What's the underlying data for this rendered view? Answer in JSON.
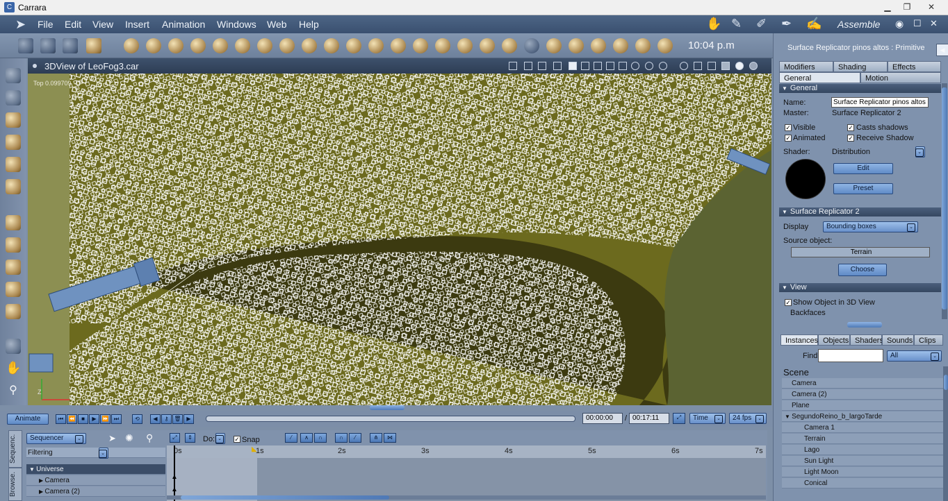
{
  "window": {
    "title": "Carrara",
    "min": "▁",
    "max": "❐",
    "close": "✕"
  },
  "menu": {
    "items": [
      "File",
      "Edit",
      "View",
      "Insert",
      "Animation",
      "Windows",
      "Web",
      "Help"
    ],
    "room": "Assemble"
  },
  "toolbar": {
    "clock": "10:04 p.m"
  },
  "view": {
    "title": "3DView of LeoFog3.car",
    "readout": "Top 0.099709"
  },
  "properties": {
    "header": "Surface Replicator pinos altos : Primitive",
    "tabs_row1": [
      "Modifiers",
      "Shading",
      "Effects"
    ],
    "tabs_row2": [
      "General",
      "Motion"
    ],
    "general": {
      "section": "General",
      "name_label": "Name:",
      "name_value": "Surface Replicator pinos altos",
      "master_label": "Master:",
      "master_value": "Surface Replicator 2",
      "visible": "Visible",
      "casts_shadows": "Casts shadows",
      "animated": "Animated",
      "receive_shadow": "Receive Shadow",
      "shader_label": "Shader:",
      "shader_value": "Distribution",
      "edit": "Edit",
      "preset": "Preset"
    },
    "replicator": {
      "section": "Surface Replicator 2",
      "display_label": "Display",
      "display_value": "Bounding boxes",
      "source_label": "Source object:",
      "source_value": "Terrain",
      "choose": "Choose"
    },
    "viewsec": {
      "section": "View",
      "show_object": "Show Object in 3D View",
      "backfaces": "Backfaces"
    }
  },
  "browser": {
    "tabs": [
      "Instances",
      "Objects",
      "Shaders",
      "Sounds",
      "Clips"
    ],
    "find_label": "Find:",
    "find_filter": "All",
    "scene_label": "Scene",
    "rows": [
      {
        "label": "Camera",
        "level": 1
      },
      {
        "label": "Camera (2)",
        "level": 1
      },
      {
        "label": "Plane",
        "level": 1
      },
      {
        "label": "SegundoReino_b_largoTarde",
        "level": 0
      },
      {
        "label": "Camera 1",
        "level": 2
      },
      {
        "label": "Terrain",
        "level": 2
      },
      {
        "label": "Lago",
        "level": 2
      },
      {
        "label": "Sun Light",
        "level": 2
      },
      {
        "label": "Light  Moon",
        "level": 2
      },
      {
        "label": "Conical",
        "level": 2
      }
    ]
  },
  "transport": {
    "animate": "Animate",
    "current_time": "00:00:00",
    "end_time": "00:17:11",
    "time_mode": "Time",
    "fps": "24 fps"
  },
  "sequencer": {
    "tabs": [
      "Sequenc.",
      "Browse."
    ],
    "mode": "Sequencer",
    "do_label": "Do:",
    "snap": "Snap",
    "filtering": "Filtering",
    "tree": [
      {
        "label": "Universe",
        "level": 0
      },
      {
        "label": "Camera",
        "level": 1
      },
      {
        "label": "Camera (2)",
        "level": 1
      }
    ],
    "ruler": [
      "0s",
      "1s",
      "2s",
      "3s",
      "4s",
      "5s",
      "6s",
      "7s"
    ]
  },
  "colors": {
    "accent": "#5f8ac6",
    "panel": "#7f92ad",
    "viewport": "#6d6a1c"
  }
}
